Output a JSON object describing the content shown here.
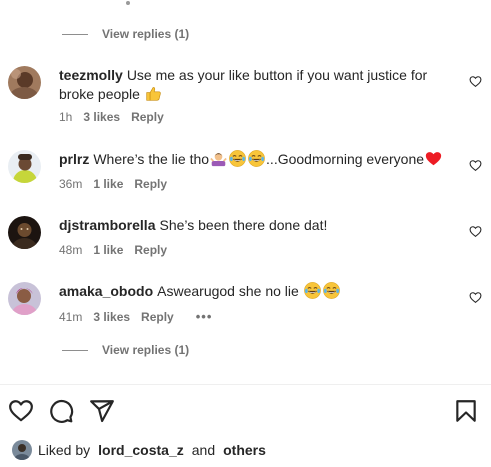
{
  "thread": {
    "view_replies_top": "View replies (1)",
    "view_replies_bottom": "View replies (1)"
  },
  "comments": [
    {
      "username": "teezmolly",
      "text": "Use me as your like button if you want justice for broke people",
      "emoji": [
        "thumbs-up"
      ],
      "time": "1h",
      "likes": "3 likes",
      "reply": "Reply"
    },
    {
      "username": "prlrz",
      "text_before": "Where’s the lie tho",
      "text_after": "...Goodmorning everyone",
      "emoji": [
        "person-shrugging",
        "tears-of-joy",
        "tears-of-joy",
        "red-heart"
      ],
      "time": "36m",
      "likes": "1 like",
      "reply": "Reply"
    },
    {
      "username": "djstramborella",
      "text": "She’s been there done dat!",
      "time": "48m",
      "likes": "1 like",
      "reply": "Reply"
    },
    {
      "username": "amaka_obodo",
      "text": "Aswearugod she no lie",
      "emoji": [
        "tears-of-joy",
        "tears-of-joy"
      ],
      "time": "41m",
      "likes": "3 likes",
      "reply": "Reply",
      "more": "•••"
    }
  ],
  "actions": {
    "icons": [
      "heart-icon",
      "comment-icon",
      "share-icon",
      "bookmark-icon"
    ]
  },
  "likes_summary": {
    "prefix": "Liked by",
    "user": "lord_costa_z",
    "joiner": "and",
    "others": "others"
  },
  "colors": {
    "text": "#262626",
    "muted": "#737373",
    "divider": "#efefef",
    "heart_red": "#ed1c24",
    "emoji_yellow": "#f8c53a"
  }
}
